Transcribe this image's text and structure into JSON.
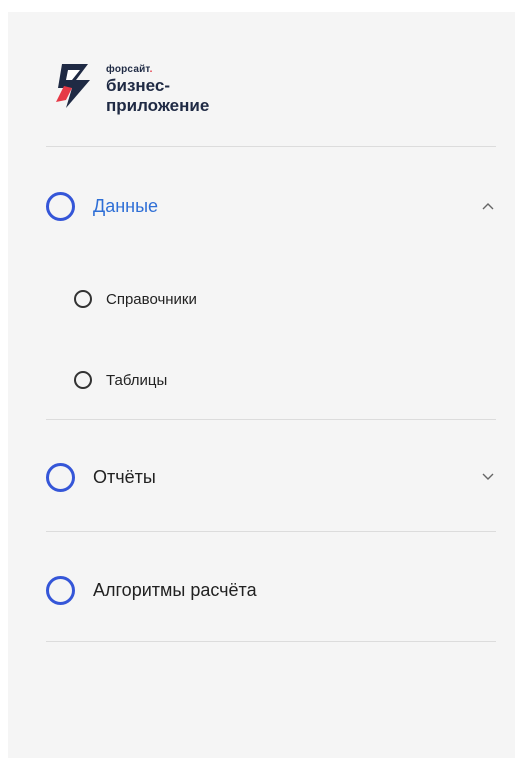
{
  "logo": {
    "brand_small": "форсайт",
    "brand_dot": ".",
    "line1": "бизнес-",
    "line2": "приложение"
  },
  "nav": {
    "data": {
      "label": "Данные",
      "expanded": true,
      "icon": "chevron-up-icon"
    },
    "sub_items": [
      {
        "label": "Справочники"
      },
      {
        "label": "Таблицы"
      }
    ],
    "reports": {
      "label": "Отчёты",
      "expanded": false,
      "icon": "chevron-down-icon"
    },
    "algorithms": {
      "label": "Алгоритмы расчёта"
    }
  },
  "colors": {
    "accent_blue": "#3556d8",
    "active_text": "#2f6fd6",
    "logo_red": "#e63946",
    "logo_navy": "#1f2a44",
    "panel_bg": "#f5f5f5"
  }
}
